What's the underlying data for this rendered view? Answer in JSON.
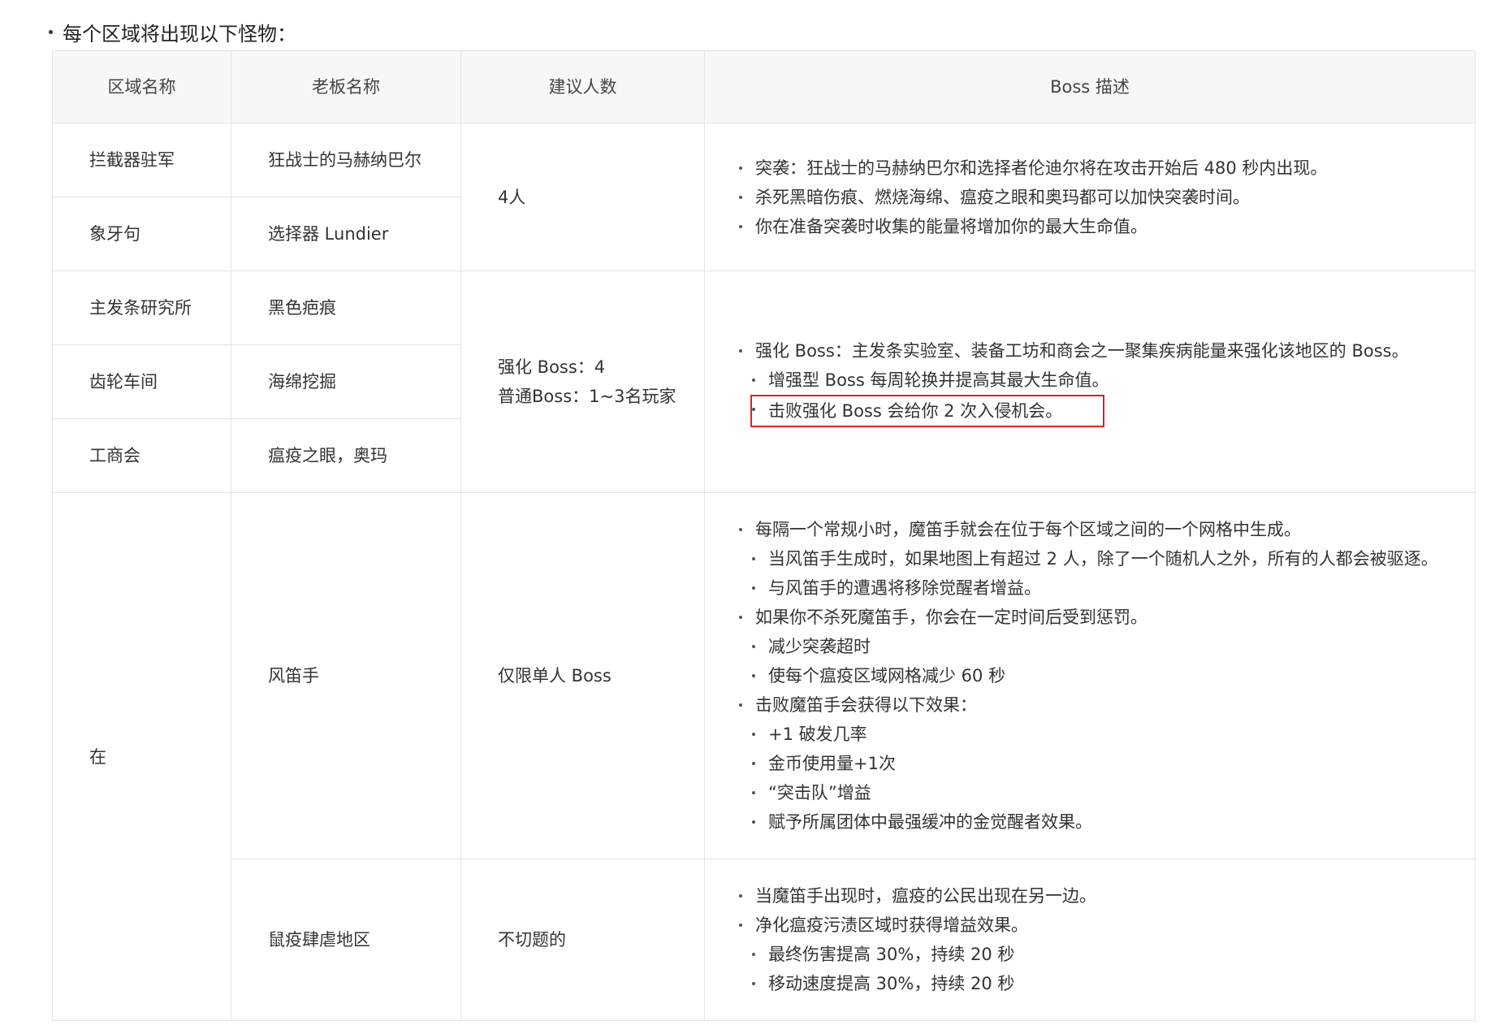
{
  "heading": "每个区域将出现以下怪物：",
  "headers": {
    "zone": "区域名称",
    "boss": "老板名称",
    "players": "建议人数",
    "desc": "Boss 描述"
  },
  "rows": [
    {
      "zone": "拦截器驻军",
      "boss": "狂战士的马赫纳巴尔"
    },
    {
      "zone": "象牙句",
      "boss": "选择器 Lundier"
    },
    {
      "zone": "主发条研究所",
      "boss": "黑色疤痕"
    },
    {
      "zone": "齿轮车间",
      "boss": "海绵挖掘"
    },
    {
      "zone": "工商会",
      "boss": "瘟疫之眼，奥玛"
    },
    {
      "zone": "在",
      "boss": "风笛手"
    },
    {
      "boss": "鼠疫肆虐地区"
    }
  ],
  "players": {
    "g1": "4人",
    "g2_line1": "强化 Boss：4",
    "g2_line2": "普通Boss：1~3名玩家",
    "g3": "仅限单人 Boss",
    "g4": "不切题的"
  },
  "desc": {
    "g1": [
      "突袭：狂战士的马赫纳巴尔和选择者伦迪尔将在攻击开始后 480 秒内出现。",
      "杀死黑暗伤痕、燃烧海绵、瘟疫之眼和奥玛都可以加快突袭时间。",
      "你在准备突袭时收集的能量将增加你的最大生命值。"
    ],
    "g2": [
      "强化 Boss：主发条实验室、装备工坊和商会之一聚集疾病能量来强化该地区的 Boss。",
      "增强型 Boss 每周轮换并提高其最大生命值。",
      "击败强化 Boss 会给你 2 次入侵机会。"
    ],
    "g3": [
      "每隔一个常规小时，魔笛手就会在位于每个区域之间的一个网格中生成。",
      "当风笛手生成时，如果地图上有超过 2 人，除了一个随机人之外，所有的人都会被驱逐。",
      "与风笛手的遭遇将移除觉醒者增益。",
      "如果你不杀死魔笛手，你会在一定时间后受到惩罚。",
      "减少突袭超时",
      "使每个瘟疫区域网格减少 60 秒",
      "击败魔笛手会获得以下效果：",
      "+1 破发几率",
      "金币使用量+1次",
      "“突击队”增益",
      "赋予所属团体中最强缓冲的金觉醒者效果。"
    ],
    "g4": [
      "当魔笛手出现时，瘟疫的公民出现在另一边。",
      "净化瘟疫污渍区域时获得增益效果。",
      "最终伤害提高 30%，持续 20 秒",
      "移动速度提高 30%，持续 20 秒"
    ]
  },
  "colors": {
    "highlight_border": "#e02020",
    "header_bg": "#f7f7f7",
    "border": "#e4e4e4"
  }
}
